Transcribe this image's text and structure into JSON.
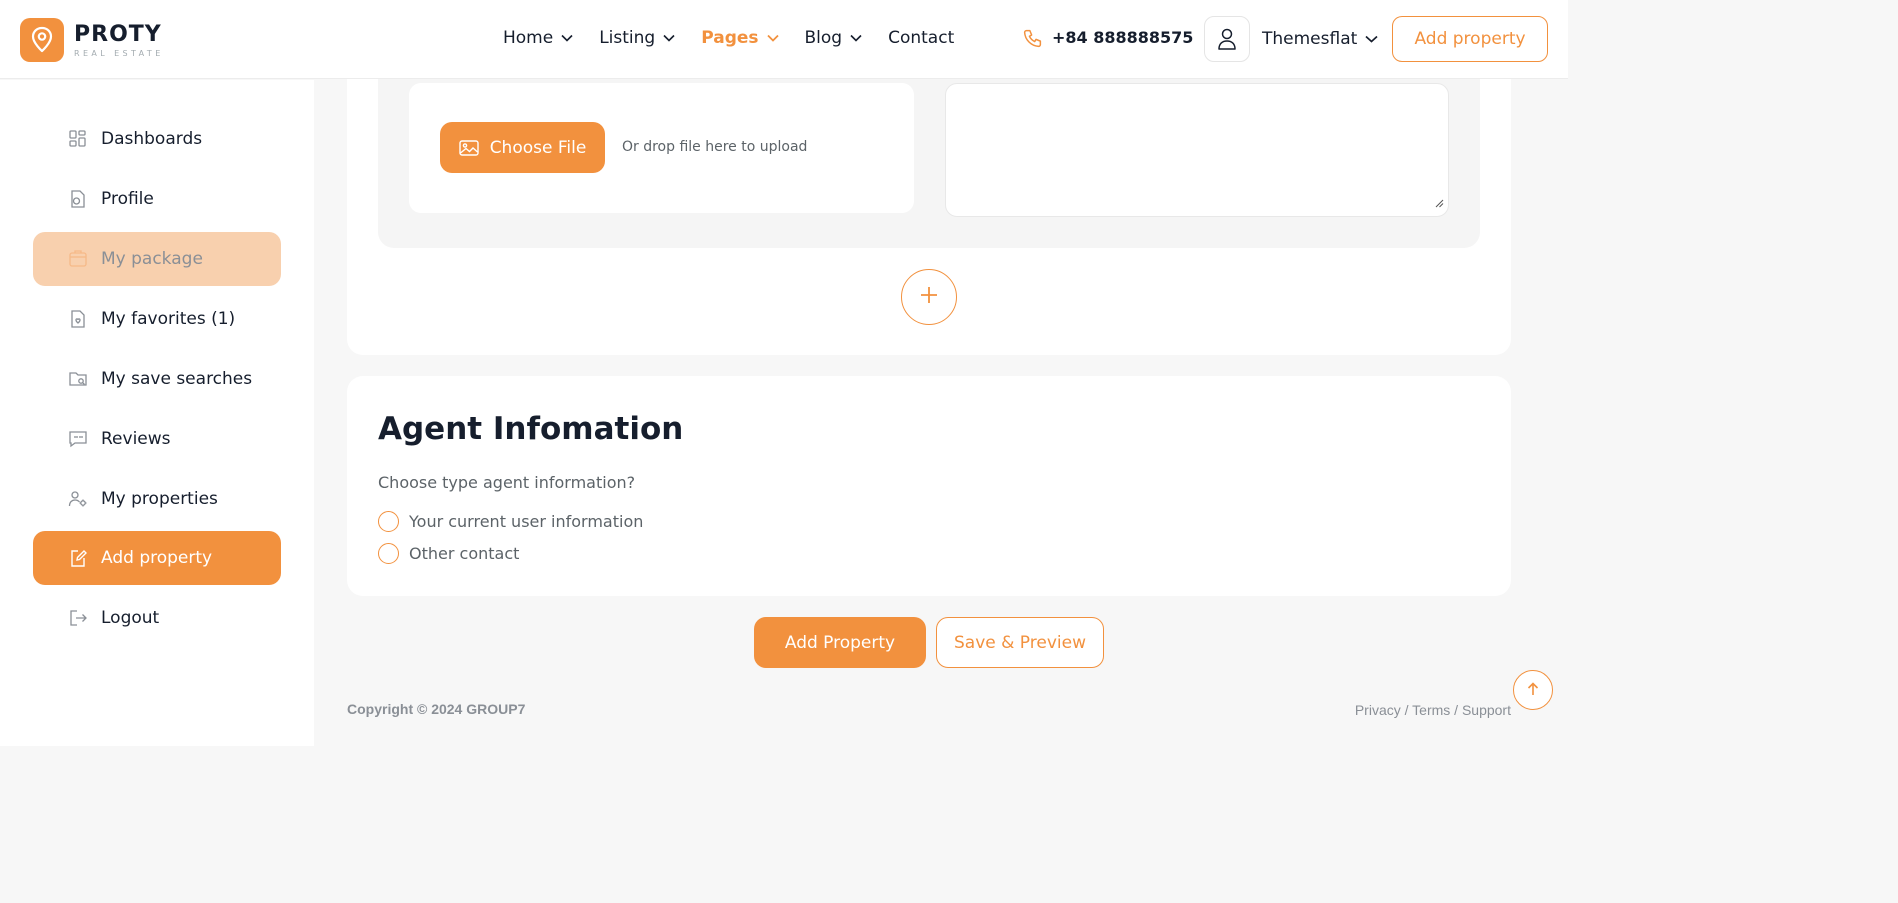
{
  "brand": {
    "name": "PROTY",
    "tagline": "REAL ESTATE",
    "accent": "#f2913e",
    "logo_icon": "location-pin-icon"
  },
  "nav": [
    {
      "label": "Home",
      "has_dropdown": true,
      "active": false
    },
    {
      "label": "Listing",
      "has_dropdown": true,
      "active": false
    },
    {
      "label": "Pages",
      "has_dropdown": true,
      "active": true
    },
    {
      "label": "Blog",
      "has_dropdown": true,
      "active": false
    },
    {
      "label": "Contact",
      "has_dropdown": false,
      "active": false
    }
  ],
  "header": {
    "phone": "+84 888888575",
    "phone_icon": "phone-icon",
    "user_name": "Themesflat",
    "user_icon": "user-icon",
    "add_property_label": "Add property"
  },
  "sidebar": {
    "items": [
      {
        "label": "Dashboards",
        "icon": "dashboard-icon",
        "state": "default"
      },
      {
        "label": "Profile",
        "icon": "profile-icon",
        "state": "default"
      },
      {
        "label": "My package",
        "icon": "package-icon",
        "state": "highlight"
      },
      {
        "label": "My favorites (1)",
        "icon": "favorites-icon",
        "state": "default"
      },
      {
        "label": "My save searches",
        "icon": "saved-search-icon",
        "state": "default"
      },
      {
        "label": "Reviews",
        "icon": "reviews-icon",
        "state": "default"
      },
      {
        "label": "My properties",
        "icon": "properties-icon",
        "state": "default"
      },
      {
        "label": "Add property",
        "icon": "add-property-icon",
        "state": "active"
      },
      {
        "label": "Logout",
        "icon": "logout-icon",
        "state": "default"
      }
    ]
  },
  "upload": {
    "choose_file_label": "Choose File",
    "choose_file_icon": "image-icon",
    "drop_text": "Or drop file here to upload",
    "description_value": "",
    "add_more_icon": "plus-icon"
  },
  "agent": {
    "title": "Agent Infomation",
    "question": "Choose type agent information?",
    "options": [
      {
        "label": "Your current user information",
        "checked": false
      },
      {
        "label": "Other contact",
        "checked": false
      }
    ]
  },
  "actions": {
    "add_property_label": "Add Property",
    "save_preview_label": "Save & Preview"
  },
  "footer": {
    "copyright": "Copyright © 2024 GROUP7",
    "links": [
      "Privacy",
      "Terms",
      "Support"
    ],
    "separator": " / ",
    "scroll_top_icon": "arrow-up-icon"
  }
}
